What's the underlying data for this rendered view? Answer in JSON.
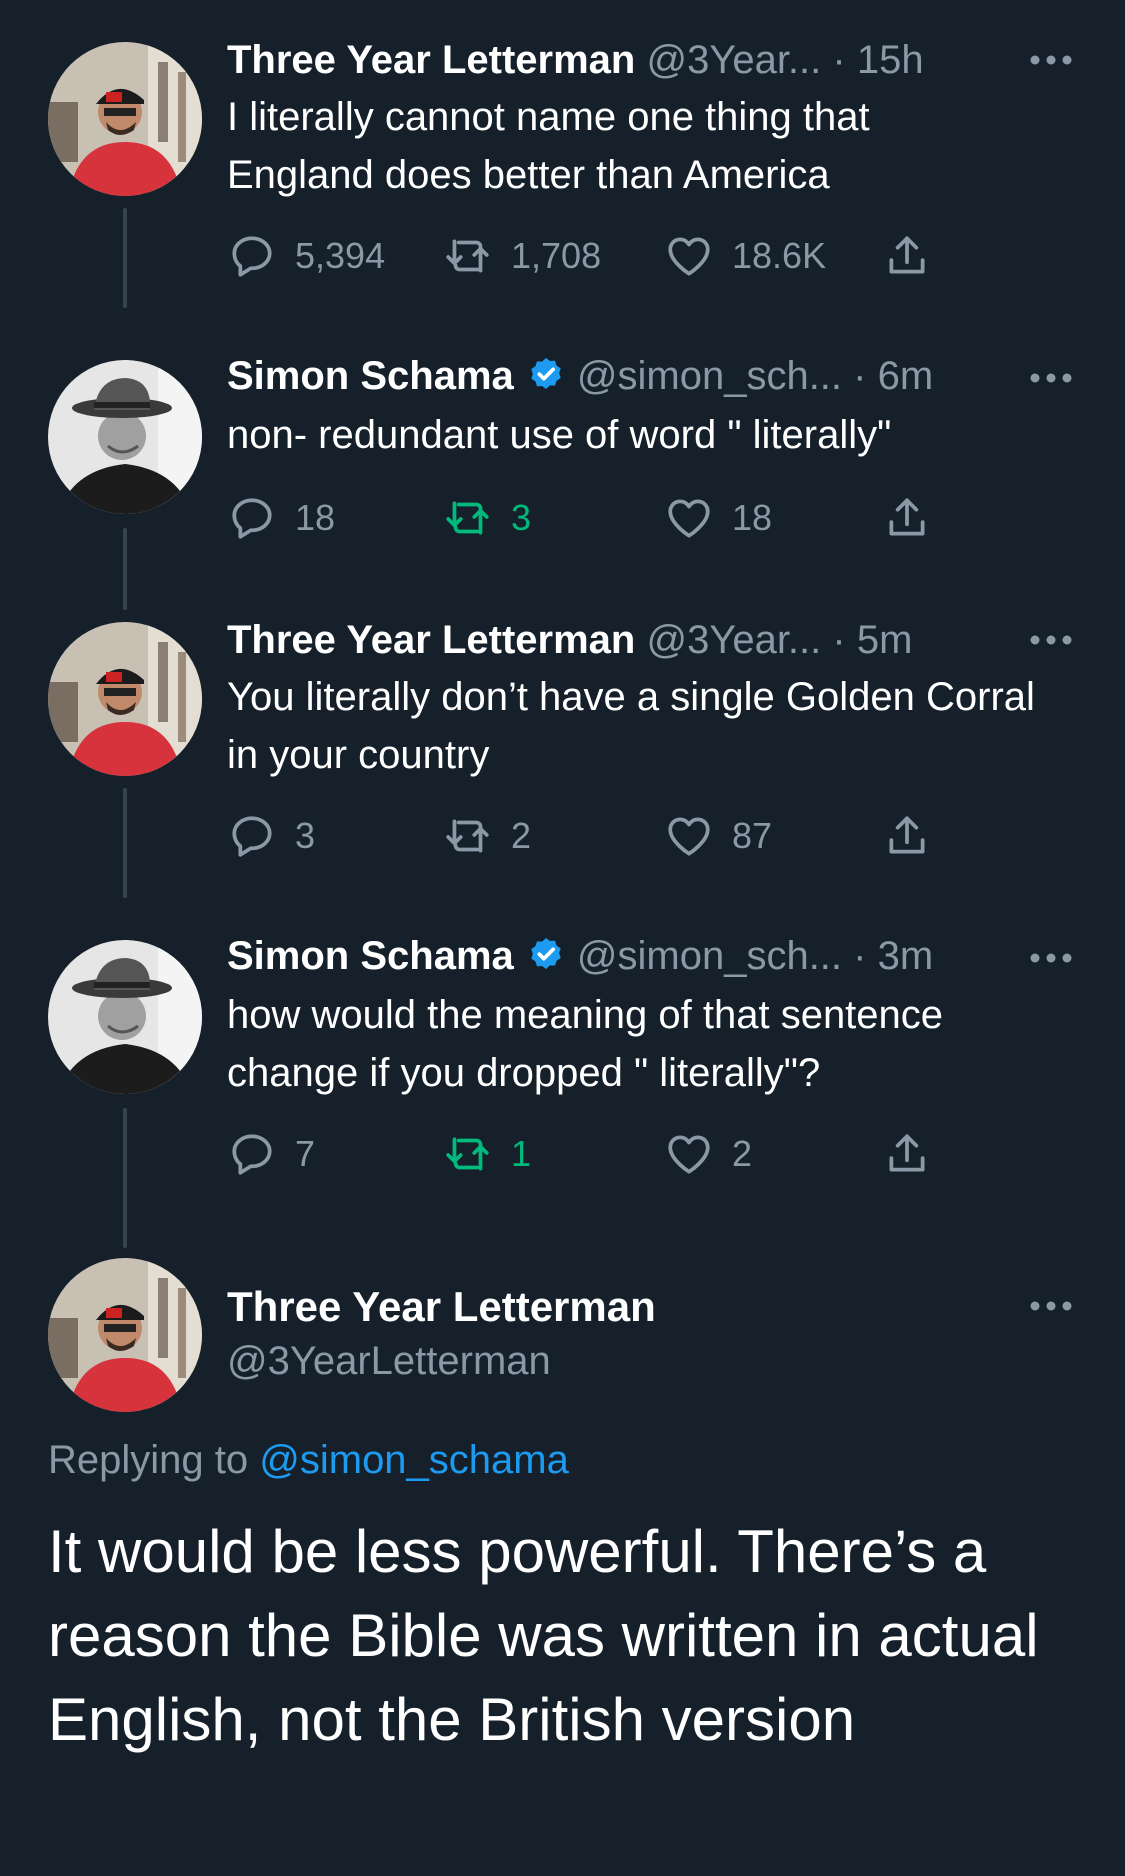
{
  "tweets": [
    {
      "name": "Three Year Letterman",
      "handle": "@3Year...",
      "dot": "·",
      "time": "15h",
      "text": "I literally cannot name one thing that England does better than America",
      "verified": false,
      "avatar_icon": "profile-photo-man-red-shirt",
      "replies": "5,394",
      "retweets": "1,708",
      "likes": "18.6K",
      "retweeted": false
    },
    {
      "name": "Simon Schama",
      "handle": "@simon_sch...",
      "dot": "·",
      "time": "6m",
      "text": "non- redundant use of word \" literally\"",
      "verified": true,
      "avatar_icon": "profile-photo-man-hat-grayscale",
      "replies": "18",
      "retweets": "3",
      "likes": "18",
      "retweeted": true
    },
    {
      "name": "Three Year Letterman",
      "handle": "@3Year...",
      "dot": "·",
      "time": "5m",
      "text": "You literally don’t have a single Golden Corral in your country",
      "verified": false,
      "avatar_icon": "profile-photo-man-red-shirt",
      "replies": "3",
      "retweets": "2",
      "likes": "87",
      "retweeted": false
    },
    {
      "name": "Simon Schama",
      "handle": "@simon_sch...",
      "dot": "·",
      "time": "3m",
      "text": "how would the meaning of that sentence change if you dropped \" literally\"?",
      "verified": true,
      "avatar_icon": "profile-photo-man-hat-grayscale",
      "replies": "7",
      "retweets": "1",
      "likes": "2",
      "retweeted": true
    }
  ],
  "focused": {
    "name": "Three Year Letterman",
    "handle": "@3YearLetterman",
    "replying_prefix": "Replying to",
    "replying_to": "@simon_schama",
    "text": "It would be less powerful. There’s a reason the Bible was written in actual English, not the British version"
  },
  "colors": {
    "background": "#15202b",
    "text": "#ffffff",
    "secondary": "#8b98a5",
    "accent": "#1d9bf0",
    "retweet_active": "#00ba7c",
    "thread_line": "#38444d"
  },
  "icons": {
    "reply": "reply-icon",
    "retweet": "retweet-icon",
    "like": "heart-icon",
    "share": "share-icon",
    "more": "more-options-icon",
    "verified": "verified-badge-icon"
  }
}
